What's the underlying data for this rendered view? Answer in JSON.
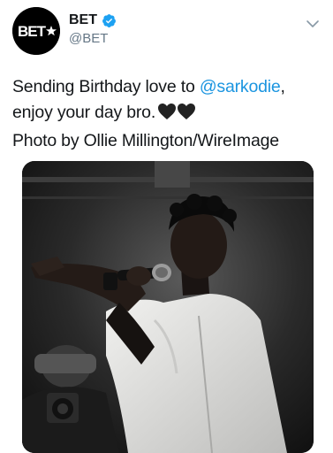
{
  "tweet": {
    "author": {
      "display_name": "BET",
      "handle": "@BET",
      "verified": true,
      "avatar_text": "BET",
      "avatar_icon": "bet-star-logo"
    },
    "text": {
      "line1_prefix": "Sending Birthday love to ",
      "mention": "@sarkodie",
      "line1_suffix": ",",
      "line2": "enjoy your day bro.",
      "emoji": "black-heart-emoji x2",
      "line3": "Photo by Ollie Millington/WireImage"
    },
    "media": {
      "type": "photo",
      "subject": "performer singing into microphone in white jacket"
    }
  },
  "colors": {
    "text": "#14171a",
    "secondary": "#657786",
    "link": "#1b95e0",
    "verified": "#1da1f2"
  }
}
